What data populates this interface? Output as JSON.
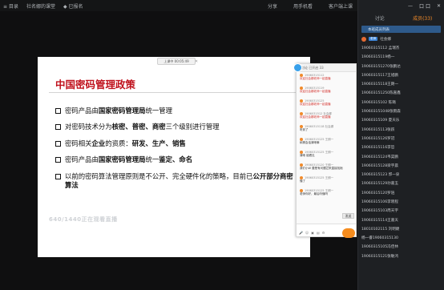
{
  "topbar": {
    "left": [
      "≡ 目录",
      "社名娜的课堂",
      "◆ 已报名"
    ],
    "right": [
      "分享",
      "用手机看",
      "客户端上课"
    ]
  },
  "sidebar": {
    "window_controls": [
      "—",
      "口 口",
      "✕"
    ],
    "tab_discuss": "讨论",
    "tab_members": "成员(33)",
    "notice": "本班成员列表",
    "top_member": {
      "tag": "老师",
      "name": "社会娜"
    },
    "members": [
      "19060315112 孟瑞杰",
      "19060315119杨一",
      "190603151270张鹏达",
      "19060315117王旭鹏",
      "19060315118王朗一",
      "190603151250陈嘉鑫",
      "19060315102 陈璐",
      "190603151048张雨森",
      "19060315109 夏天乐",
      "19060315113张跃",
      "19060315126罗冠",
      "19060315116李哲",
      "19060315124韦昊鹏",
      "19060315128梁宇晨",
      "19060315123 郭一泉",
      "19060315129孙嘉玉",
      "19060315120罗逍",
      "19060315106李晓程",
      "19060315103周天宇",
      "19060315114王嘉天",
      "18010102115 刘明婕",
      "杨一睿19060315130",
      "19060315105冯佳林",
      "19060315121张敏鸿"
    ]
  },
  "slide": {
    "title": "中国密码管理政策",
    "bullets": [
      [
        {
          "t": "密码产品由",
          "b": false
        },
        {
          "t": "国家密码管理局",
          "b": true
        },
        {
          "t": "统一管理",
          "b": false
        }
      ],
      [
        {
          "t": "对密码技术分为",
          "b": false
        },
        {
          "t": "核密、普密、商密",
          "b": true
        },
        {
          "t": "三个级别进行管理",
          "b": false
        }
      ],
      [
        {
          "t": "密码相关",
          "b": false
        },
        {
          "t": "企业",
          "b": true
        },
        {
          "t": "的资质：",
          "b": false
        },
        {
          "t": "研发、生产、销售",
          "b": true
        }
      ],
      [
        {
          "t": "密码产品由",
          "b": false
        },
        {
          "t": "国家密码管理局",
          "b": true
        },
        {
          "t": "统一",
          "b": false
        },
        {
          "t": "鉴定、命名",
          "b": true
        }
      ],
      [
        {
          "t": "以前的密码算法管理原则是不公开、完全硬件化的策略，目前已",
          "b": false
        },
        {
          "t": "公开部分商密算法",
          "b": true
        }
      ]
    ],
    "watermark": "640/1440正在观看直播"
  },
  "slide_control": {
    "label": "上课中 00:05:49"
  },
  "chat": {
    "header": "讨论 已开启 33",
    "messages": [
      {
        "who": "19060315112",
        "text": "欢迎社会娜老师一起直播"
      },
      {
        "who": "19060315119",
        "text": "欢迎社会娜老师一起直播"
      },
      {
        "who": "19060315125",
        "text": "欢迎社会娜老师一起直播"
      },
      {
        "who": "1906031512 社会娜",
        "text": "欢迎社会娜老师一起直播"
      },
      {
        "who": "19060315118 社会娜",
        "text": "听到了"
      },
      {
        "who": "19060315125 王朗一",
        "text": "私聊会话清晰嘛"
      },
      {
        "who": "19060315125 王朗一",
        "text": "清晰 能看见"
      },
      {
        "who": "19060315120 王朗一",
        "text": "我们小W 要是有问题过来直接找她"
      },
      {
        "who": "19060315125 王朗一",
        "text": "懂了"
      },
      {
        "who": "19060315125 王朗一",
        "text": "老师你好，最后听懂吗"
      }
    ],
    "send": "发送"
  }
}
